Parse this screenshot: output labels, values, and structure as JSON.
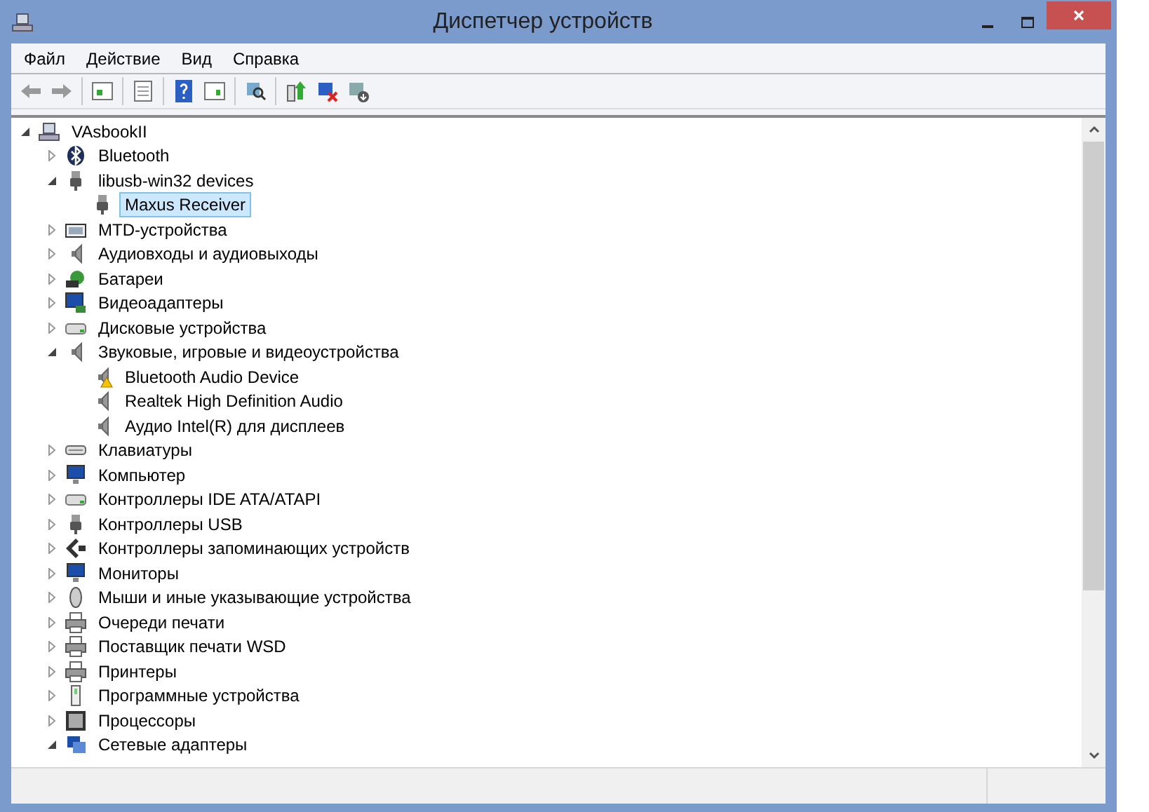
{
  "window": {
    "title": "Диспетчер устройств"
  },
  "menu": [
    {
      "label": "Файл"
    },
    {
      "label": "Действие"
    },
    {
      "label": "Вид"
    },
    {
      "label": "Справка"
    }
  ],
  "tree": {
    "label": "VAsbookII",
    "kind": "computer",
    "expanded": true,
    "selected": false,
    "children": [
      {
        "label": "Bluetooth",
        "kind": "bluetooth",
        "expanded": false,
        "selected": false
      },
      {
        "label": "libusb-win32 devices",
        "kind": "usb",
        "expanded": true,
        "selected": false,
        "children": [
          {
            "label": "Maxus Receiver",
            "kind": "usb",
            "selected": true,
            "warning": false
          }
        ]
      },
      {
        "label": "MTD-устройства",
        "kind": "mtd",
        "expanded": false,
        "selected": false
      },
      {
        "label": "Аудиовходы и аудиовыходы",
        "kind": "audio",
        "expanded": false,
        "selected": false
      },
      {
        "label": "Батареи",
        "kind": "battery",
        "expanded": false,
        "selected": false
      },
      {
        "label": "Видеоадаптеры",
        "kind": "display",
        "expanded": false,
        "selected": false
      },
      {
        "label": "Дисковые устройства",
        "kind": "disk",
        "expanded": false,
        "selected": false
      },
      {
        "label": "Звуковые, игровые и видеоустройства",
        "kind": "audio",
        "expanded": true,
        "selected": false,
        "children": [
          {
            "label": "Bluetooth Audio Device",
            "kind": "audio",
            "selected": false,
            "warning": true
          },
          {
            "label": "Realtek High Definition Audio",
            "kind": "audio",
            "selected": false,
            "warning": false
          },
          {
            "label": "Аудио Intel(R) для дисплеев",
            "kind": "audio",
            "selected": false,
            "warning": false
          }
        ]
      },
      {
        "label": "Клавиатуры",
        "kind": "keyboard",
        "expanded": false,
        "selected": false
      },
      {
        "label": "Компьютер",
        "kind": "monitor",
        "expanded": false,
        "selected": false
      },
      {
        "label": "Контроллеры IDE ATA/ATAPI",
        "kind": "disk",
        "expanded": false,
        "selected": false
      },
      {
        "label": "Контроллеры USB",
        "kind": "usb",
        "expanded": false,
        "selected": false
      },
      {
        "label": "Контроллеры запоминающих устройств",
        "kind": "storage",
        "expanded": false,
        "selected": false
      },
      {
        "label": "Мониторы",
        "kind": "monitor",
        "expanded": false,
        "selected": false
      },
      {
        "label": "Мыши и иные указывающие устройства",
        "kind": "mouse",
        "expanded": false,
        "selected": false
      },
      {
        "label": "Очереди печати",
        "kind": "printer",
        "expanded": false,
        "selected": false
      },
      {
        "label": "Поставщик печати WSD",
        "kind": "printer",
        "expanded": false,
        "selected": false
      },
      {
        "label": "Принтеры",
        "kind": "printer",
        "expanded": false,
        "selected": false
      },
      {
        "label": "Программные устройства",
        "kind": "software",
        "expanded": false,
        "selected": false
      },
      {
        "label": "Процессоры",
        "kind": "cpu",
        "expanded": false,
        "selected": false
      },
      {
        "label": "Сетевые адаптеры",
        "kind": "network",
        "expanded": true,
        "selected": false
      }
    ]
  }
}
